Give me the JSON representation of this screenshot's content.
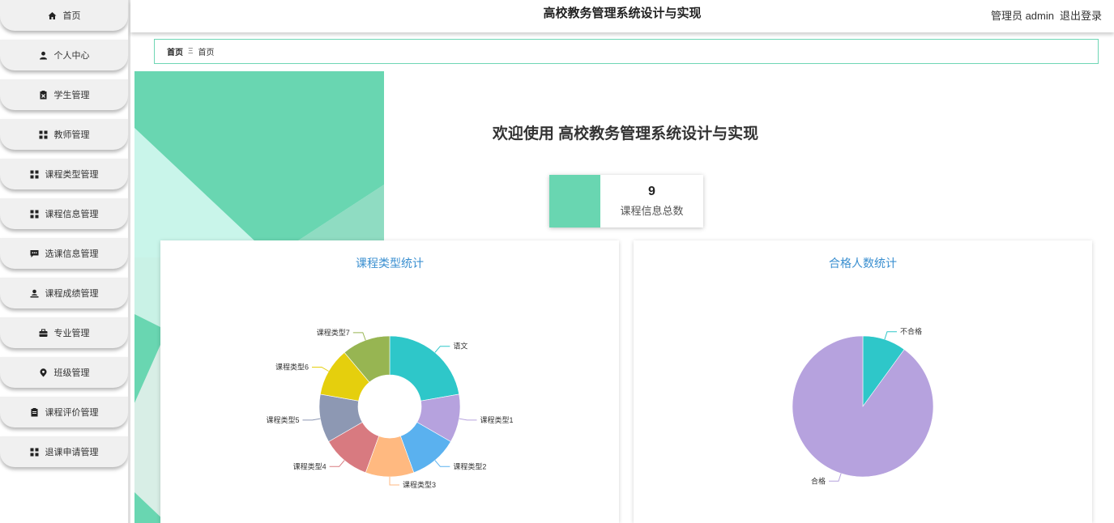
{
  "header": {
    "title": "高校教务管理系统设计与实现",
    "admin_label": "管理员 admin",
    "logout_label": "退出登录"
  },
  "sidebar": {
    "items": [
      {
        "label": "首页",
        "icon": "home-icon"
      },
      {
        "label": "个人中心",
        "icon": "user-icon"
      },
      {
        "label": "学生管理",
        "icon": "clipboard-x-icon"
      },
      {
        "label": "教师管理",
        "icon": "grid-icon"
      },
      {
        "label": "课程类型管理",
        "icon": "grid-icon"
      },
      {
        "label": "课程信息管理",
        "icon": "grid-icon"
      },
      {
        "label": "选课信息管理",
        "icon": "chat-icon"
      },
      {
        "label": "课程成绩管理",
        "icon": "user-upload-icon"
      },
      {
        "label": "专业管理",
        "icon": "briefcase-icon"
      },
      {
        "label": "班级管理",
        "icon": "map-pin-icon"
      },
      {
        "label": "课程评价管理",
        "icon": "clipboard-icon"
      },
      {
        "label": "退课申请管理",
        "icon": "grid-icon"
      }
    ]
  },
  "breadcrumb": {
    "home": "首页",
    "separator": "Ξ",
    "current": "首页"
  },
  "main": {
    "welcome": "欢迎使用 高校教务管理系统设计与实现",
    "stat": {
      "value": "9",
      "label": "课程信息总数"
    }
  },
  "colors": {
    "accent": "#69d6b1",
    "chart_title": "#3a8fd0"
  },
  "chart_data": [
    {
      "type": "pie",
      "title": "课程类型统计",
      "donut": true,
      "categories": [
        "语文",
        "课程类型1",
        "课程类型2",
        "课程类型3",
        "课程类型4",
        "课程类型5",
        "课程类型6",
        "课程类型7"
      ],
      "values": [
        2,
        1,
        1,
        1,
        1,
        1,
        1,
        1
      ],
      "colors": [
        "#2ec7c9",
        "#b6a2de",
        "#5ab1ef",
        "#ffb980",
        "#d87a80",
        "#8d98b3",
        "#e5cf0d",
        "#97b552"
      ]
    },
    {
      "type": "pie",
      "title": "合格人数统计",
      "donut": false,
      "categories": [
        "不合格",
        "合格"
      ],
      "values": [
        1,
        9
      ],
      "colors": [
        "#2ec7c9",
        "#b6a2de"
      ]
    }
  ]
}
